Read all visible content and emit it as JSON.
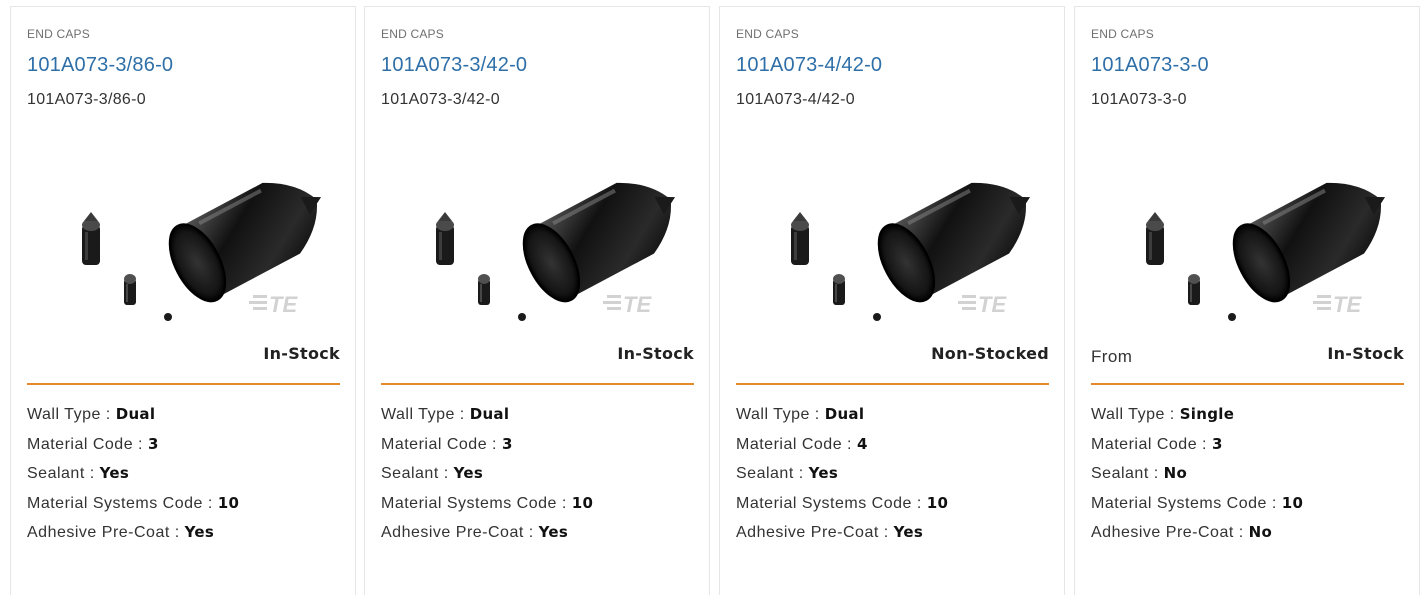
{
  "products": [
    {
      "category": "END CAPS",
      "title": "101A073-3/86-0",
      "part_number": "101A073-3/86-0",
      "from_label": "",
      "stock": "In-Stock",
      "logo_text": "TE",
      "specs": {
        "wall_type_label": "Wall Type : ",
        "wall_type": "Dual",
        "material_code_label": "Material Code : ",
        "material_code": "3",
        "sealant_label": "Sealant : ",
        "sealant": "Yes",
        "material_systems_code_label": "Material Systems Code : ",
        "material_systems_code": "10",
        "adhesive_label": "Adhesive Pre-Coat : ",
        "adhesive": "Yes"
      }
    },
    {
      "category": "END CAPS",
      "title": "101A073-3/42-0",
      "part_number": "101A073-3/42-0",
      "from_label": "",
      "stock": "In-Stock",
      "logo_text": "TE",
      "specs": {
        "wall_type_label": "Wall Type : ",
        "wall_type": "Dual",
        "material_code_label": "Material Code : ",
        "material_code": "3",
        "sealant_label": "Sealant : ",
        "sealant": "Yes",
        "material_systems_code_label": "Material Systems Code : ",
        "material_systems_code": "10",
        "adhesive_label": "Adhesive Pre-Coat : ",
        "adhesive": "Yes"
      }
    },
    {
      "category": "END CAPS",
      "title": "101A073-4/42-0",
      "part_number": "101A073-4/42-0",
      "from_label": "",
      "stock": "Non-Stocked",
      "logo_text": "TE",
      "specs": {
        "wall_type_label": "Wall Type : ",
        "wall_type": "Dual",
        "material_code_label": "Material Code : ",
        "material_code": "4",
        "sealant_label": "Sealant : ",
        "sealant": "Yes",
        "material_systems_code_label": "Material Systems Code : ",
        "material_systems_code": "10",
        "adhesive_label": "Adhesive Pre-Coat : ",
        "adhesive": "Yes"
      }
    },
    {
      "category": "END CAPS",
      "title": "101A073-3-0",
      "part_number": "101A073-3-0",
      "from_label": "From",
      "stock": "In-Stock",
      "logo_text": "TE",
      "specs": {
        "wall_type_label": "Wall Type : ",
        "wall_type": "Single",
        "material_code_label": "Material Code : ",
        "material_code": "3",
        "sealant_label": "Sealant : ",
        "sealant": "No",
        "material_systems_code_label": "Material Systems Code : ",
        "material_systems_code": "10",
        "adhesive_label": "Adhesive Pre-Coat : ",
        "adhesive": "No"
      }
    }
  ],
  "colors": {
    "link": "#2f6fa8",
    "divider": "#e38a2a",
    "card_border": "#e6e6e6"
  }
}
